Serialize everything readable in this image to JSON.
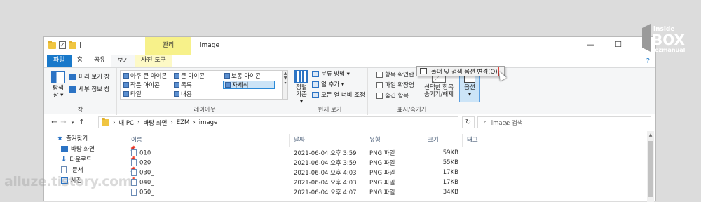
{
  "quick_access": {
    "separator": "|"
  },
  "title": {
    "context_tab": "관리",
    "folder_name": "image"
  },
  "window_buttons": {
    "minimize": "—",
    "maximize": "☐",
    "close": "✕"
  },
  "ribbon_tabs": [
    "파일",
    "홈",
    "공유",
    "보기",
    "사진 도구"
  ],
  "help_icon": "?",
  "pane_group": {
    "nav_pane": "탐색\n창 ▾",
    "preview_pane": "미리 보기 창",
    "details_pane": "세부 정보 창",
    "label": "창"
  },
  "layout_group": {
    "items": [
      "아주 큰 아이콘",
      "큰 아이콘",
      "보통 아이콘",
      "작은 아이콘",
      "목록",
      "자세히",
      "타일",
      "내용"
    ],
    "label": "레이아웃"
  },
  "current_view_group": {
    "sort_by": "정렬\n기준 ▾",
    "group_by": "분류 방법 ▾",
    "add_columns": "열 추가 ▾",
    "size_all_columns": "모든 열 너비 조정",
    "label": "현재 보기"
  },
  "show_hide_group": {
    "item_checkboxes": "항목 확인란",
    "file_extensions": "파일 확장명",
    "hidden_items": "숨긴 항목",
    "hide_selected": "선택한 항목\n숨기기/해제",
    "label": "표시/숨기기"
  },
  "options": {
    "label": "옵션\n▾",
    "dropdown_item": "폴더 및 검색 옵션 변경(O)"
  },
  "address": {
    "path": [
      "내 PC",
      "바탕 화면",
      "EZM",
      "image"
    ],
    "search_placeholder": "image 검색"
  },
  "nav_pane": {
    "items": [
      {
        "label": "즐겨찾기",
        "icon": "star-icon"
      },
      {
        "label": "바탕 화면",
        "icon": "desktop-icon"
      },
      {
        "label": "다운로드",
        "icon": "download-icon"
      },
      {
        "label": "문서",
        "icon": "document-icon"
      },
      {
        "label": "사진",
        "icon": "pictures-icon"
      }
    ]
  },
  "columns": [
    "이름",
    "날짜",
    "유형",
    "크기",
    "태그"
  ],
  "files": [
    {
      "name": "010_",
      "date": "2021-06-04 오후 3:59",
      "type": "PNG 파일",
      "size": "59KB"
    },
    {
      "name": "020_",
      "date": "2021-06-04 오후 3:59",
      "type": "PNG 파일",
      "size": "55KB"
    },
    {
      "name": "030_",
      "date": "2021-06-04 오후 4:03",
      "type": "PNG 파일",
      "size": "17KB"
    },
    {
      "name": "040_",
      "date": "2021-06-04 오후 4:03",
      "type": "PNG 파일",
      "size": "17KB"
    },
    {
      "name": "050_",
      "date": "2021-06-04 오후 4:07",
      "type": "PNG 파일",
      "size": "34KB"
    }
  ],
  "watermarks": {
    "site": "alluze.tistory.com",
    "brand_top": "inside",
    "brand_mid": "BOX",
    "brand_bottom": "ezmanual"
  }
}
